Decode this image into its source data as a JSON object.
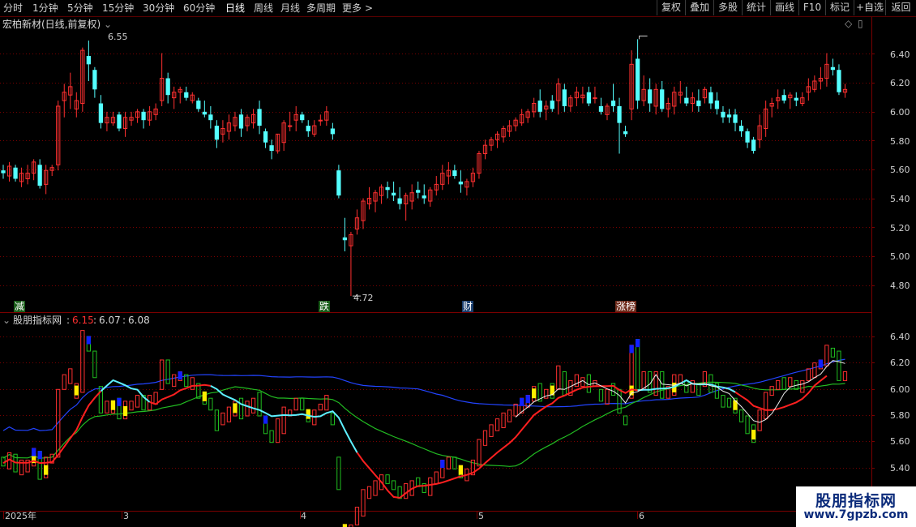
{
  "toolbar": {
    "periods": [
      "分时",
      "1分钟",
      "5分钟",
      "15分钟",
      "30分钟",
      "60分钟",
      "日线",
      "周线",
      "月线",
      "多周期",
      "更多"
    ],
    "active_period": "日线",
    "more_arrow": ">",
    "right_buttons": [
      "复权",
      "叠加",
      "多股",
      "统计",
      "画线",
      "F10",
      "标记",
      "+自选",
      "返回"
    ]
  },
  "main_chart": {
    "title": "宏柏新材(日线,前复权)",
    "high_label": "6.55",
    "low_label": "4.72",
    "y_ticks": [
      "6.40",
      "6.20",
      "6.00",
      "5.80",
      "5.60",
      "5.40",
      "5.20",
      "5.00",
      "4.80"
    ],
    "event_markers": [
      {
        "text": "减",
        "color": "#ffffff",
        "bg": "#1a5e1a"
      },
      {
        "text": "跌",
        "color": "#ffffff",
        "bg": "#1a5e1a"
      },
      {
        "text": "财",
        "color": "#ffffff",
        "bg": "#1a3e6e"
      },
      {
        "text": "涨榜",
        "color": "#ffffff",
        "bg": "#6e2a1a"
      }
    ]
  },
  "indicator": {
    "title": "股朋指标网",
    "value1": "6.15",
    "value2": "6.07",
    "value3": "6.08",
    "y_ticks": [
      "6.40",
      "6.20",
      "6.00",
      "5.80",
      "5.60",
      "5.40"
    ]
  },
  "x_axis": {
    "labels": [
      "2025年",
      "3",
      "4",
      "5",
      "6"
    ]
  },
  "watermark": {
    "title": "股朋指标网",
    "url": "www.7gpzb.com"
  },
  "colors": {
    "up": "#ff3030",
    "down": "#54ffff",
    "grid": "#7a0000",
    "ma_red": "#ff2020",
    "ma_cyan": "#5ef0ff",
    "ma_green": "#22bb22",
    "ma_blue": "#2244ff",
    "ma_white": "#f0f0f0",
    "block_yellow": "#ffee00",
    "block_blue": "#1020ff",
    "block_green": "#20c020"
  },
  "chart_data": {
    "type": "candlestick",
    "title": "宏柏新材(日线,前复权)",
    "ylim": [
      4.68,
      6.62
    ],
    "ohlc": [
      [
        5.62,
        5.66,
        5.56,
        5.6
      ],
      [
        5.58,
        5.68,
        5.54,
        5.65
      ],
      [
        5.64,
        5.66,
        5.54,
        5.56
      ],
      [
        5.54,
        5.64,
        5.5,
        5.6
      ],
      [
        5.56,
        5.66,
        5.52,
        5.6
      ],
      [
        5.6,
        5.7,
        5.55,
        5.68
      ],
      [
        5.66,
        5.7,
        5.49,
        5.51
      ],
      [
        5.52,
        5.66,
        5.45,
        5.62
      ],
      [
        5.62,
        5.66,
        5.58,
        5.64
      ],
      [
        5.66,
        6.12,
        5.62,
        6.08
      ],
      [
        6.12,
        6.24,
        6.0,
        6.18
      ],
      [
        6.16,
        6.32,
        6.06,
        6.22
      ],
      [
        6.06,
        6.18,
        6.0,
        6.12
      ],
      [
        6.1,
        6.5,
        6.04,
        6.48
      ],
      [
        6.44,
        6.55,
        6.26,
        6.38
      ],
      [
        6.34,
        6.36,
        6.14,
        6.2
      ],
      [
        6.1,
        6.16,
        5.92,
        5.96
      ],
      [
        5.96,
        6.04,
        5.9,
        6.0
      ],
      [
        5.96,
        6.04,
        5.94,
        6.0
      ],
      [
        6.02,
        6.04,
        5.9,
        5.92
      ],
      [
        5.92,
        6.04,
        5.86,
        6.0
      ],
      [
        5.98,
        6.04,
        5.94,
        6.0
      ],
      [
        6.0,
        6.06,
        5.96,
        6.04
      ],
      [
        6.04,
        6.06,
        5.92,
        5.98
      ],
      [
        5.98,
        6.08,
        5.94,
        6.04
      ],
      [
        6.02,
        6.1,
        5.98,
        6.06
      ],
      [
        6.12,
        6.46,
        6.08,
        6.28
      ],
      [
        6.28,
        6.32,
        6.1,
        6.16
      ],
      [
        6.14,
        6.22,
        6.06,
        6.18
      ],
      [
        6.18,
        6.22,
        6.1,
        6.2
      ],
      [
        6.18,
        6.22,
        6.12,
        6.14
      ],
      [
        6.12,
        6.18,
        6.1,
        6.16
      ],
      [
        6.12,
        6.14,
        6.04,
        6.06
      ],
      [
        6.04,
        6.12,
        6.0,
        6.02
      ],
      [
        6.02,
        6.08,
        5.92,
        5.98
      ],
      [
        5.94,
        5.98,
        5.78,
        5.84
      ],
      [
        5.88,
        5.98,
        5.82,
        5.92
      ],
      [
        5.9,
        6.02,
        5.84,
        5.96
      ],
      [
        5.94,
        6.04,
        5.9,
        6.0
      ],
      [
        6.02,
        6.06,
        5.86,
        5.92
      ],
      [
        5.94,
        6.02,
        5.9,
        6.0
      ],
      [
        5.96,
        6.06,
        5.92,
        6.02
      ],
      [
        6.06,
        6.12,
        5.88,
        5.94
      ],
      [
        5.9,
        5.92,
        5.78,
        5.82
      ],
      [
        5.8,
        5.84,
        5.7,
        5.76
      ],
      [
        5.76,
        5.88,
        5.74,
        5.88
      ],
      [
        5.82,
        5.98,
        5.76,
        5.96
      ],
      [
        5.94,
        6.04,
        5.9,
        5.94
      ],
      [
        5.98,
        6.08,
        5.9,
        6.02
      ],
      [
        6.02,
        6.04,
        5.96,
        5.98
      ],
      [
        5.94,
        5.98,
        5.86,
        5.9
      ],
      [
        5.88,
        5.98,
        5.86,
        5.94
      ],
      [
        5.98,
        6.02,
        5.94,
        5.98
      ],
      [
        5.98,
        6.08,
        5.94,
        6.04
      ],
      [
        5.92,
        5.96,
        5.84,
        5.88
      ],
      [
        5.62,
        5.66,
        5.42,
        5.44
      ],
      [
        5.14,
        5.28,
        5.04,
        5.12
      ],
      [
        5.08,
        5.18,
        4.72,
        5.16
      ],
      [
        5.2,
        5.34,
        5.16,
        5.28
      ],
      [
        5.26,
        5.42,
        5.2,
        5.4
      ],
      [
        5.38,
        5.5,
        5.34,
        5.42
      ],
      [
        5.4,
        5.48,
        5.32,
        5.46
      ],
      [
        5.44,
        5.52,
        5.38,
        5.5
      ],
      [
        5.5,
        5.54,
        5.42,
        5.48
      ],
      [
        5.46,
        5.54,
        5.4,
        5.44
      ],
      [
        5.42,
        5.5,
        5.34,
        5.38
      ],
      [
        5.38,
        5.46,
        5.26,
        5.44
      ],
      [
        5.4,
        5.52,
        5.34,
        5.46
      ],
      [
        5.48,
        5.54,
        5.42,
        5.46
      ],
      [
        5.44,
        5.52,
        5.38,
        5.42
      ],
      [
        5.4,
        5.5,
        5.36,
        5.48
      ],
      [
        5.48,
        5.58,
        5.44,
        5.52
      ],
      [
        5.52,
        5.66,
        5.48,
        5.6
      ],
      [
        5.58,
        5.68,
        5.52,
        5.62
      ],
      [
        5.62,
        5.66,
        5.56,
        5.58
      ],
      [
        5.54,
        5.62,
        5.46,
        5.52
      ],
      [
        5.5,
        5.56,
        5.44,
        5.54
      ],
      [
        5.54,
        5.64,
        5.5,
        5.6
      ],
      [
        5.6,
        5.76,
        5.56,
        5.74
      ],
      [
        5.74,
        5.84,
        5.7,
        5.8
      ],
      [
        5.8,
        5.86,
        5.76,
        5.84
      ],
      [
        5.84,
        5.9,
        5.78,
        5.88
      ],
      [
        5.86,
        5.94,
        5.82,
        5.92
      ],
      [
        5.9,
        5.98,
        5.86,
        5.94
      ],
      [
        5.94,
        6.0,
        5.9,
        5.98
      ],
      [
        5.96,
        6.06,
        5.94,
        6.02
      ],
      [
        6.0,
        6.06,
        5.96,
        6.04
      ],
      [
        6.04,
        6.14,
        6.0,
        6.1
      ],
      [
        6.12,
        6.2,
        6.0,
        6.04
      ],
      [
        6.06,
        6.12,
        5.98,
        6.08
      ],
      [
        6.12,
        6.16,
        6.04,
        6.06
      ],
      [
        6.12,
        6.28,
        6.02,
        6.24
      ],
      [
        6.2,
        6.24,
        6.04,
        6.08
      ],
      [
        6.08,
        6.16,
        6.04,
        6.14
      ],
      [
        6.14,
        6.22,
        6.08,
        6.18
      ],
      [
        6.14,
        6.22,
        6.1,
        6.16
      ],
      [
        6.18,
        6.22,
        6.08,
        6.1
      ],
      [
        6.14,
        6.22,
        6.1,
        6.14
      ],
      [
        6.08,
        6.14,
        6.02,
        6.04
      ],
      [
        6.02,
        6.1,
        5.98,
        6.08
      ],
      [
        6.12,
        6.24,
        6.04,
        6.08
      ],
      [
        6.08,
        6.14,
        5.74,
        5.96
      ],
      [
        5.9,
        5.94,
        5.86,
        5.88
      ],
      [
        6.06,
        6.48,
        5.98,
        6.38
      ],
      [
        6.42,
        6.56,
        6.06,
        6.12
      ],
      [
        6.12,
        6.3,
        6.08,
        6.2
      ],
      [
        6.2,
        6.28,
        6.04,
        6.1
      ],
      [
        6.08,
        6.24,
        6.02,
        6.2
      ],
      [
        6.2,
        6.26,
        6.04,
        6.06
      ],
      [
        6.06,
        6.14,
        6.0,
        6.1
      ],
      [
        6.08,
        6.22,
        6.02,
        6.18
      ],
      [
        6.16,
        6.26,
        6.1,
        6.18
      ],
      [
        6.14,
        6.22,
        6.08,
        6.1
      ],
      [
        6.1,
        6.18,
        6.04,
        6.14
      ],
      [
        6.12,
        6.2,
        6.04,
        6.08
      ],
      [
        6.14,
        6.22,
        6.1,
        6.2
      ],
      [
        6.18,
        6.22,
        6.06,
        6.1
      ],
      [
        6.12,
        6.18,
        6.02,
        6.06
      ],
      [
        6.04,
        6.08,
        5.96,
        6.0
      ],
      [
        6.02,
        6.06,
        5.96,
        6.0
      ],
      [
        6.02,
        6.06,
        5.9,
        5.96
      ],
      [
        5.94,
        5.98,
        5.86,
        5.9
      ],
      [
        5.9,
        5.92,
        5.78,
        5.82
      ],
      [
        5.84,
        5.86,
        5.74,
        5.76
      ],
      [
        5.84,
        6.02,
        5.78,
        5.94
      ],
      [
        5.92,
        6.12,
        5.86,
        6.06
      ],
      [
        6.08,
        6.14,
        6.0,
        6.1
      ],
      [
        6.12,
        6.2,
        6.06,
        6.14
      ],
      [
        6.16,
        6.2,
        6.1,
        6.12
      ],
      [
        6.14,
        6.18,
        6.06,
        6.16
      ],
      [
        6.14,
        6.18,
        6.08,
        6.12
      ],
      [
        6.1,
        6.18,
        6.08,
        6.14
      ],
      [
        6.18,
        6.28,
        6.12,
        6.22
      ],
      [
        6.2,
        6.3,
        6.18,
        6.26
      ],
      [
        6.26,
        6.36,
        6.2,
        6.28
      ],
      [
        6.28,
        6.46,
        6.22,
        6.38
      ],
      [
        6.36,
        6.42,
        6.3,
        6.34
      ],
      [
        6.34,
        6.38,
        6.16,
        6.18
      ],
      [
        6.18,
        6.24,
        6.14,
        6.2
      ]
    ]
  }
}
